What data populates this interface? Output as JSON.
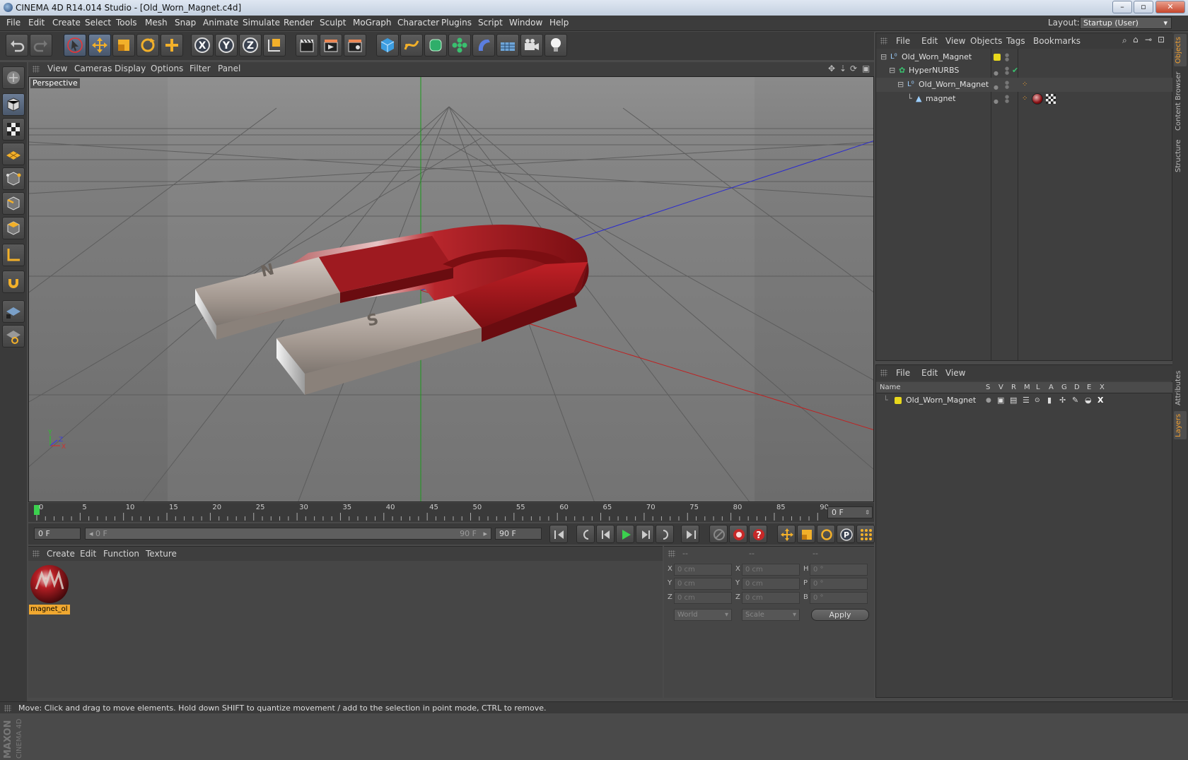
{
  "window": {
    "title": "CINEMA 4D R14.014 Studio - [Old_Worn_Magnet.c4d]",
    "min": "–",
    "max": "▫",
    "close": "✕"
  },
  "menubar": {
    "items": [
      "File",
      "Edit",
      "Create",
      "Select",
      "Tools",
      "Mesh",
      "Snap",
      "Animate",
      "Simulate",
      "Render",
      "Sculpt",
      "MoGraph",
      "Character",
      "Plugins",
      "Script",
      "Window",
      "Help"
    ],
    "layout_label": "Layout:",
    "layout_value": "Startup (User)"
  },
  "viewport": {
    "menu": [
      "View",
      "Cameras",
      "Display",
      "Options",
      "Filter",
      "Panel"
    ],
    "camera_label": "Perspective",
    "axis_x": "X",
    "axis_y": "Y",
    "axis_z": "Z",
    "mark_n": "N",
    "mark_s": "S"
  },
  "timeline": {
    "ticks": [
      "0",
      "5",
      "10",
      "15",
      "20",
      "25",
      "30",
      "35",
      "40",
      "45",
      "50",
      "55",
      "60",
      "65",
      "70",
      "75",
      "80",
      "85",
      "90"
    ],
    "current_frame": "0 F"
  },
  "transport": {
    "start_field": "0 F",
    "range_start": "0 F",
    "range_end": "90 F",
    "end_field": "90 F"
  },
  "materials": {
    "menu": [
      "Create",
      "Edit",
      "Function",
      "Texture"
    ],
    "items": [
      {
        "label": "magnet_ol"
      }
    ]
  },
  "coordinates": {
    "header": [
      "--",
      "--",
      "--"
    ],
    "rows": [
      {
        "l1": "X",
        "v1": "0 cm",
        "l2": "X",
        "v2": "0 cm",
        "l3": "H",
        "v3": "0 °"
      },
      {
        "l1": "Y",
        "v1": "0 cm",
        "l2": "Y",
        "v2": "0 cm",
        "l3": "P",
        "v3": "0 °"
      },
      {
        "l1": "Z",
        "v1": "0 cm",
        "l2": "Z",
        "v2": "0 cm",
        "l3": "B",
        "v3": "0 °"
      }
    ],
    "mode": "World",
    "type": "Scale",
    "apply": "Apply"
  },
  "objects": {
    "menu": [
      "File",
      "Edit",
      "View",
      "Objects",
      "Tags",
      "Bookmarks"
    ],
    "tree": [
      {
        "name": "Old_Worn_Magnet",
        "indent": 0
      },
      {
        "name": "HyperNURBS",
        "indent": 1
      },
      {
        "name": "Old_Worn_Magnet",
        "indent": 2
      },
      {
        "name": "magnet",
        "indent": 3
      }
    ]
  },
  "layers": {
    "menu": [
      "File",
      "Edit",
      "View"
    ],
    "columns": [
      "Name",
      "S",
      "V",
      "R",
      "M",
      "L",
      "A",
      "G",
      "D",
      "E",
      "X"
    ],
    "rows": [
      {
        "name": "Old_Worn_Magnet"
      }
    ]
  },
  "sidetabs": [
    "Objects",
    "Content Browser",
    "Structure",
    "Attributes",
    "Layers"
  ],
  "brand": "MAXON CINEMA 4D",
  "status": "Move: Click and drag to move elements. Hold down SHIFT to quantize movement / add to the selection in point mode, CTRL to remove.",
  "colors": {
    "accent": "#f0a830",
    "magnet_red": "#a8161c",
    "layer_yellow": "#e8d81c"
  }
}
